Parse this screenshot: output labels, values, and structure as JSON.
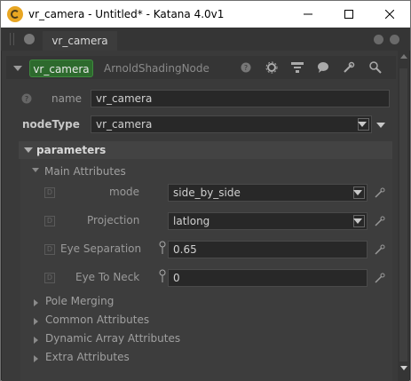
{
  "window": {
    "title": "vr_camera - Untitled* - Katana 4.0v1"
  },
  "tabs": [
    {
      "label": "vr_camera"
    }
  ],
  "node": {
    "name_pill": "vr_camera",
    "type": "ArnoldShadingNode"
  },
  "fields": {
    "name_label": "name",
    "name_value": "vr_camera",
    "nodetype_label": "nodeType",
    "nodetype_value": "vr_camera"
  },
  "parameters": {
    "header": "parameters",
    "main_attributes": "Main Attributes",
    "rows": [
      {
        "label": "mode",
        "value": "side_by_side",
        "kind": "dropdown"
      },
      {
        "label": "Projection",
        "value": "latlong",
        "kind": "dropdown"
      },
      {
        "label": "Eye Separation",
        "value": "0.65",
        "kind": "number"
      },
      {
        "label": "Eye To Neck",
        "value": "0",
        "kind": "number"
      }
    ],
    "groups": [
      "Pole Merging",
      "Common Attributes",
      "Dynamic Array Attributes",
      "Extra Attributes"
    ]
  },
  "colors": {
    "accent_green": "#2d6a2d",
    "bg": "#3a3a3a"
  }
}
